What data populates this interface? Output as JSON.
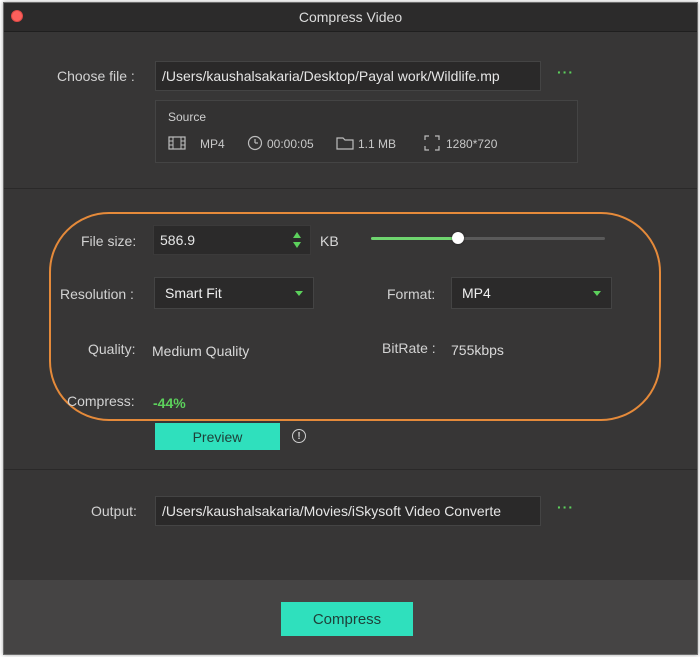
{
  "window": {
    "title": "Compress Video"
  },
  "choose_file": {
    "label": "Choose file :",
    "path": "/Users/kaushalsakaria/Desktop/Payal work/Wildlife.mp",
    "more": "···"
  },
  "source": {
    "title": "Source",
    "format": "MP4",
    "duration": "00:00:05",
    "size": "1.1 MB",
    "resolution": "1280*720"
  },
  "file_size": {
    "label": "File size:",
    "value": "586.9",
    "unit": "KB",
    "slider_fraction": 0.37
  },
  "resolution": {
    "label": "Resolution :",
    "selected": "Smart Fit"
  },
  "format": {
    "label": "Format:",
    "selected": "MP4"
  },
  "quality": {
    "label": "Quality:",
    "value": "Medium Quality"
  },
  "bitrate": {
    "label": "BitRate :",
    "value": "755kbps"
  },
  "compress_ratio": {
    "label": "Compress:",
    "value": "-44%"
  },
  "preview": {
    "label": "Preview",
    "info": "!"
  },
  "output": {
    "label": "Output:",
    "path": "/Users/kaushalsakaria/Movies/iSkysoft Video Converte",
    "more": "···"
  },
  "footer": {
    "compress_label": "Compress"
  },
  "colors": {
    "accent": "#2fe0bd",
    "green": "#5cd15c",
    "highlight": "#e58a3a"
  }
}
